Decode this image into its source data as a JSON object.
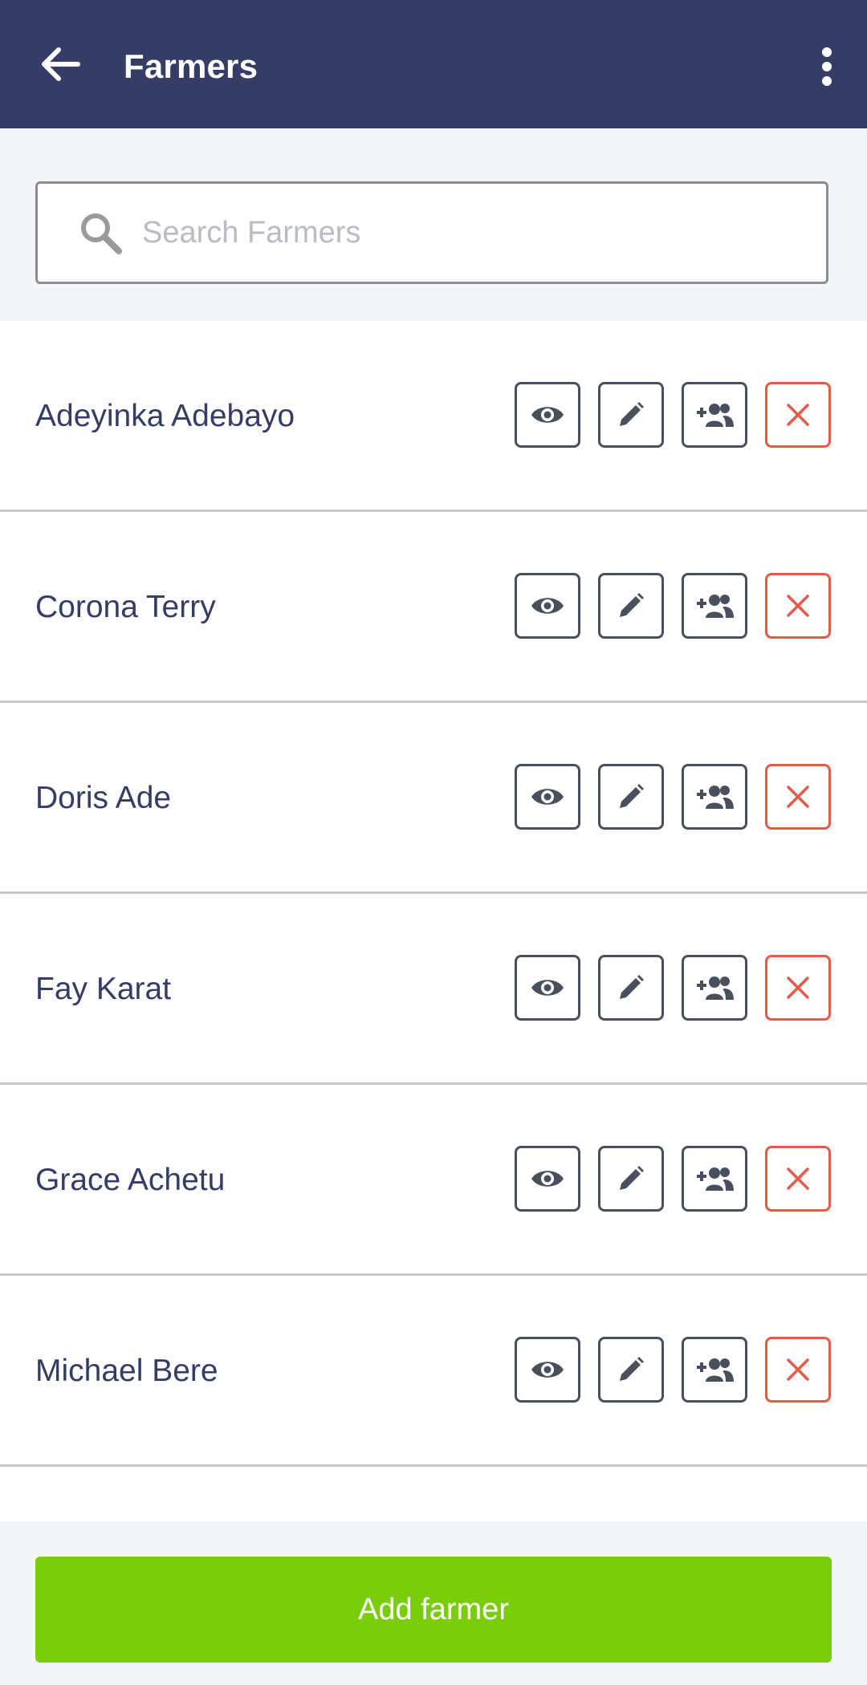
{
  "appbar": {
    "title": "Farmers",
    "back_icon": "arrow-left-icon",
    "menu_icon": "more-vertical-icon",
    "background": "#353d66"
  },
  "search": {
    "placeholder": "Search Farmers",
    "value": "",
    "icon": "search-icon"
  },
  "farmers": [
    {
      "name": "Adeyinka Adebayo"
    },
    {
      "name": "Corona Terry"
    },
    {
      "name": "Doris Ade"
    },
    {
      "name": "Fay Karat"
    },
    {
      "name": "Grace Achetu"
    },
    {
      "name": "Michael Bere"
    },
    {
      "name": ""
    }
  ],
  "row_actions": [
    "eye-icon",
    "pencil-icon",
    "add-group-icon",
    "close-icon"
  ],
  "footer": {
    "add_label": "Add farmer",
    "accent": "#7acd0b"
  },
  "colors": {
    "delete": "#e55a47",
    "text": "#353d66"
  }
}
